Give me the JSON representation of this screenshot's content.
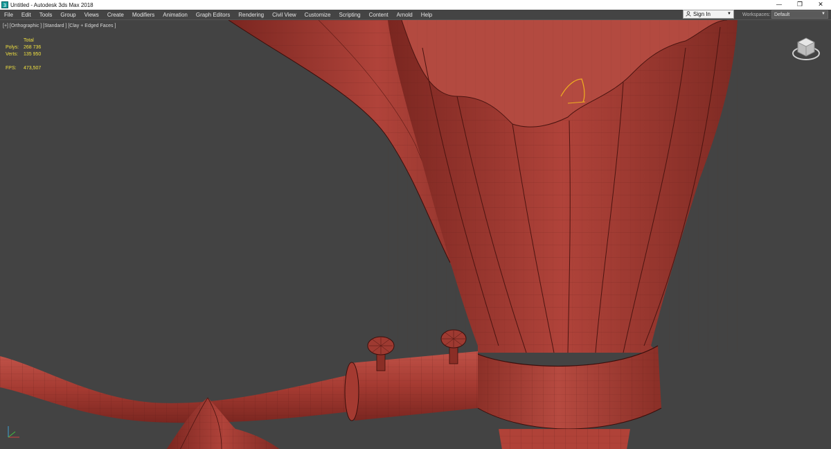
{
  "window": {
    "title": "Untitled - Autodesk 3ds Max 2018",
    "minimize": "—",
    "restore": "❐",
    "close": "✕"
  },
  "menu": {
    "items": [
      "File",
      "Edit",
      "Tools",
      "Group",
      "Views",
      "Create",
      "Modifiers",
      "Animation",
      "Graph Editors",
      "Rendering",
      "Civil View",
      "Customize",
      "Scripting",
      "Content",
      "Arnold",
      "Help"
    ]
  },
  "account": {
    "signin_label": "Sign In"
  },
  "workspaces": {
    "label": "Workspaces:",
    "value": "Default"
  },
  "viewport": {
    "label": "[+] [Orthographic ] [Standard ] [Clay + Edged Faces ]",
    "stats": {
      "header": "Total",
      "polys_label": "Polys:",
      "polys_value": "268 736",
      "verts_label": "Verts:",
      "verts_value": "135 950",
      "fps_label": "FPS:",
      "fps_value": "473,507"
    }
  },
  "colors": {
    "viewport_bg": "#434343",
    "clay": "#a83a30",
    "wire": "#5a1a15",
    "stats_text": "#f0e040",
    "selection": "#f0b020"
  }
}
